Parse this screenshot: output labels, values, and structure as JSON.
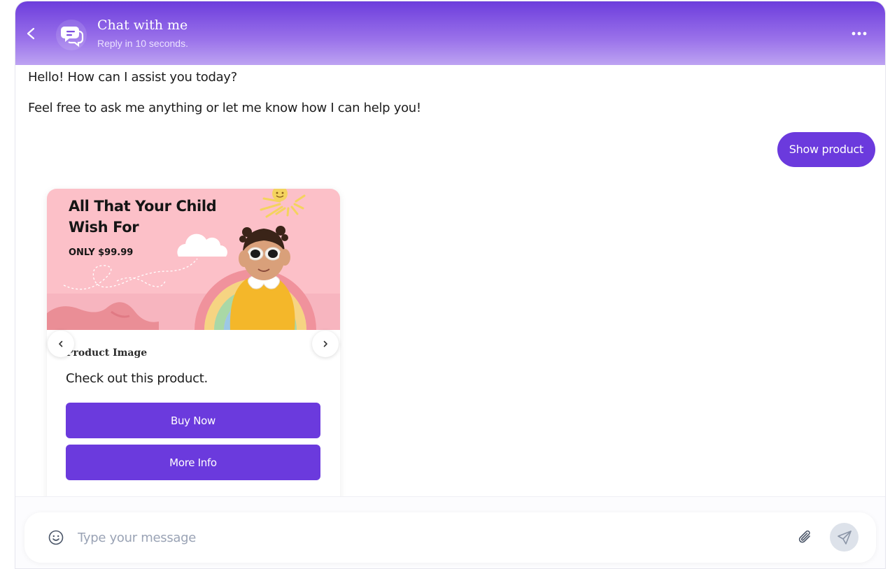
{
  "header": {
    "title": "Chat with me",
    "subtitle": "Reply in 10 seconds."
  },
  "messages": {
    "bot_line_1": "Hello! How can I assist you today?",
    "bot_line_2": "Feel free to ask me anything or let me know how I can help you!",
    "user_message": "Show product"
  },
  "product_card": {
    "image": {
      "headline": "All That Your Child Wish For",
      "price": "ONLY $99.99"
    },
    "title": "Product Image",
    "description": "Check out this product.",
    "buy_label": "Buy Now",
    "info_label": "More Info"
  },
  "composer": {
    "placeholder": "Type your message"
  },
  "colors": {
    "accent": "#6b3add",
    "header_top": "#6d3ddc",
    "header_bottom": "#bda3f2",
    "card_image_bg": "#fcc0c8"
  }
}
